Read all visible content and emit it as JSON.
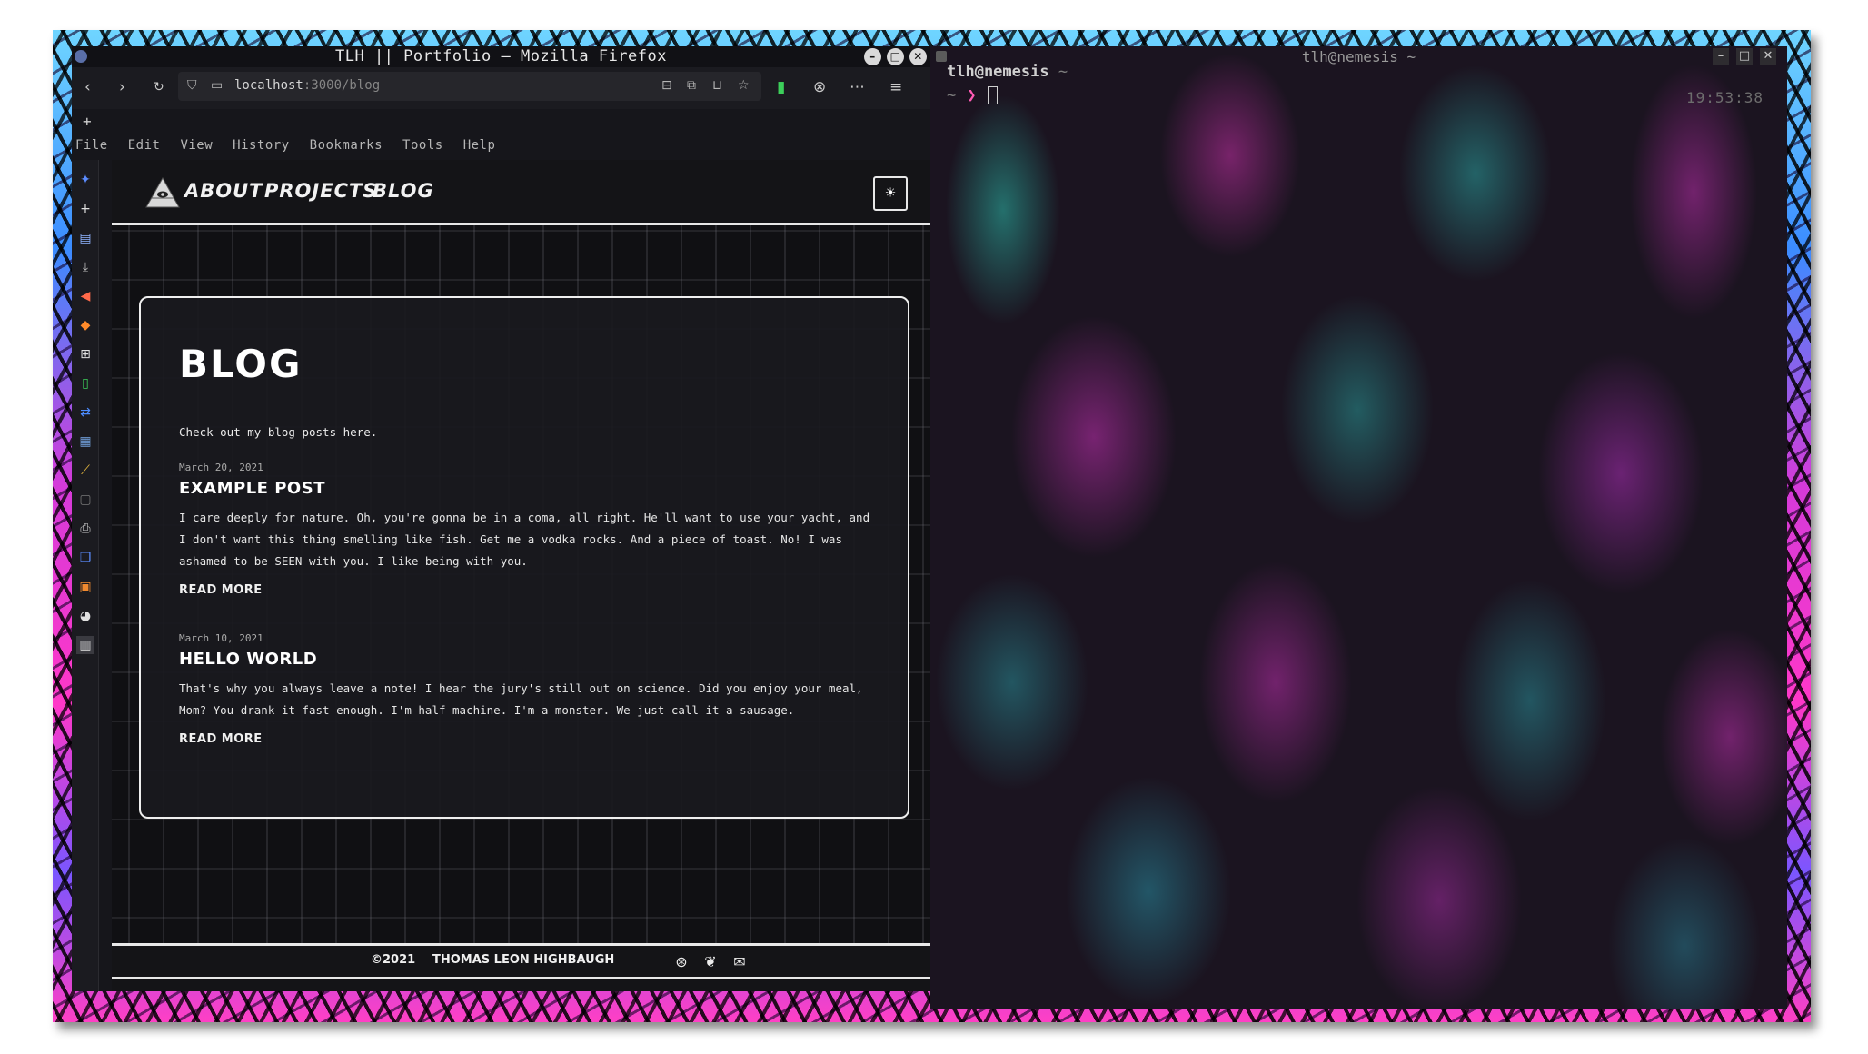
{
  "browser": {
    "window_title": "TLH || Portfolio — Mozilla Firefox",
    "url_host": "localhost",
    "url_path": ":3000/blog",
    "menu": [
      "File",
      "Edit",
      "View",
      "History",
      "Bookmarks",
      "Tools",
      "Help"
    ],
    "new_tab_glyph": "+"
  },
  "site": {
    "nav": [
      "About",
      "Projects",
      "Blog"
    ],
    "page_title": "Blog",
    "intro": "Check out my blog posts here.",
    "posts": [
      {
        "date": "March 20, 2021",
        "title": "Example Post",
        "body": "I care deeply for nature. Oh, you're gonna be in a coma, all right. He'll want to use your yacht, and I don't want this thing smelling like fish. Get me a vodka rocks. And a piece of toast. No! I was ashamed to be SEEN with you. I like being with you.",
        "read_more": "Read More"
      },
      {
        "date": "March 10, 2021",
        "title": "Hello World",
        "body": "That's why you always leave a note! I hear the jury's still out on science. Did you enjoy your meal, Mom? You drank it fast enough. I'm half machine. I'm a monster. We just call it a sausage.",
        "read_more": "Read More"
      }
    ],
    "footer": {
      "copyright": "©2021",
      "name": "Thomas Leon Highbaugh",
      "icons": [
        "github-icon",
        "twitter-icon",
        "mail-icon"
      ]
    }
  },
  "terminal": {
    "window_title": "tlh@nemesis ~",
    "prompt_user": "tlh@nemesis",
    "prompt_dir": "~",
    "line_prefix": "~",
    "arrow": "❯",
    "clock": "19:53:38"
  },
  "colors": {
    "page_bg": "#141417",
    "card_border": "#efefef",
    "terminal_arrow": "#ff5ab4"
  }
}
